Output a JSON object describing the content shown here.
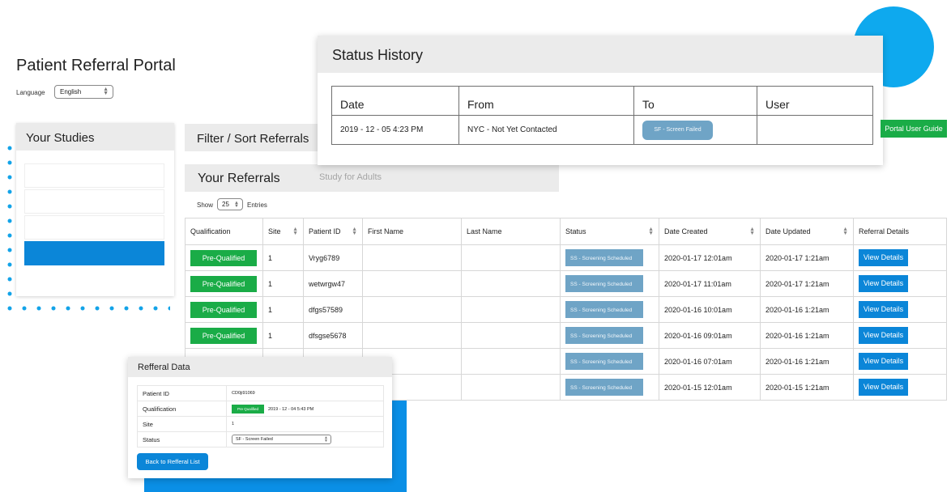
{
  "app": {
    "title": "Patient Referral Portal",
    "language_label": "Language",
    "language_value": "English"
  },
  "studies": {
    "title": "Your Studies",
    "items": [
      "",
      "",
      "",
      ""
    ],
    "active_index": 3
  },
  "filter": {
    "title": "Filter / Sort Referrals"
  },
  "referrals": {
    "title": "Your Referrals",
    "subtitle": "Study for Adults",
    "show_label": "Show",
    "show_value": "25",
    "entries_label": "Entries",
    "columns": [
      "Qualification",
      "Site",
      "Patient ID",
      "First Name",
      "Last Name",
      "Status",
      "Date Created",
      "Date Updated",
      "Referral Details"
    ],
    "rows": [
      {
        "qualification": "Pre-Qualified",
        "site": "1",
        "patient_id": "Vryg6789",
        "first_name": "",
        "last_name": "",
        "status": "SS - Screening Scheduled",
        "date_created": "2020-01-17 12:01am",
        "date_updated": "2020-01-17 1:21am",
        "details": "View Details"
      },
      {
        "qualification": "Pre-Qualified",
        "site": "1",
        "patient_id": "wetwrgw47",
        "first_name": "",
        "last_name": "",
        "status": "SS - Screening Scheduled",
        "date_created": "2020-01-17 11:01am",
        "date_updated": "2020-01-17 1:21am",
        "details": "View Details"
      },
      {
        "qualification": "Pre-Qualified",
        "site": "1",
        "patient_id": "dfgs57589",
        "first_name": "",
        "last_name": "",
        "status": "SS - Screening Scheduled",
        "date_created": "2020-01-16 10:01am",
        "date_updated": "2020-01-16 1:21am",
        "details": "View Details"
      },
      {
        "qualification": "Pre-Qualified",
        "site": "1",
        "patient_id": "dfsgse5678",
        "first_name": "",
        "last_name": "",
        "status": "SS - Screening Scheduled",
        "date_created": "2020-01-16 09:01am",
        "date_updated": "2020-01-16 1:21am",
        "details": "View Details"
      },
      {
        "qualification": "",
        "site": "",
        "patient_id": "",
        "first_name": "",
        "last_name": "",
        "status": "SS - Screening Scheduled",
        "date_created": "2020-01-16 07:01am",
        "date_updated": "2020-01-16 1:21am",
        "details": "View Details"
      },
      {
        "qualification": "",
        "site": "",
        "patient_id": "",
        "first_name": "",
        "last_name": "",
        "status": "SS - Screening Scheduled",
        "date_created": "2020-01-15 12:01am",
        "date_updated": "2020-01-15 1:21am",
        "details": "View Details"
      }
    ]
  },
  "status_history": {
    "title": "Status History",
    "columns": [
      "Date",
      "From",
      "To",
      "User"
    ],
    "rows": [
      {
        "date": "2019 - 12 - 05 4:23 PM",
        "from": "NYC - Not Yet Contacted",
        "to": "SF - Screen Failed",
        "user": ""
      }
    ]
  },
  "portal_guide_label": "Portal User Guide",
  "referral_data": {
    "title": "Refferal Data",
    "fields": [
      {
        "label": "Patient ID",
        "value": "CD0ji91069"
      },
      {
        "label": "Qualification",
        "badge": "Pre Qualified",
        "value": "2019 - 12 - 04 5:43 PM"
      },
      {
        "label": "Site",
        "value": "1"
      },
      {
        "label": "Status",
        "value": "SF - Screen Failed"
      }
    ],
    "back_label": "Back to Refferal List"
  },
  "colors": {
    "primary_blue": "#0b86d8",
    "success_green": "#1aac47",
    "status_pill": "#6fa4c6",
    "panel_header": "#ebebeb"
  }
}
